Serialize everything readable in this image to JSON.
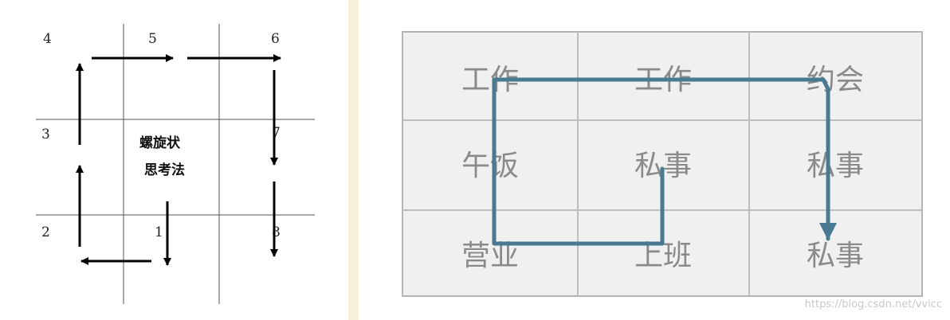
{
  "left_diagram": {
    "numbers": [
      "4",
      "5",
      "6",
      "3",
      "7",
      "2",
      "1",
      "8"
    ],
    "center_line1": "螺旋状",
    "center_line2": "思考法"
  },
  "right_diagram": {
    "cells": [
      "工作",
      "工作",
      "约会",
      "午饭",
      "私事",
      "私事",
      "营业",
      "上班",
      "私事"
    ],
    "path_color": "#4a7a92",
    "cell_bg": "#f0f0f0"
  },
  "watermark": "https://blog.csdn.net/vvicc"
}
